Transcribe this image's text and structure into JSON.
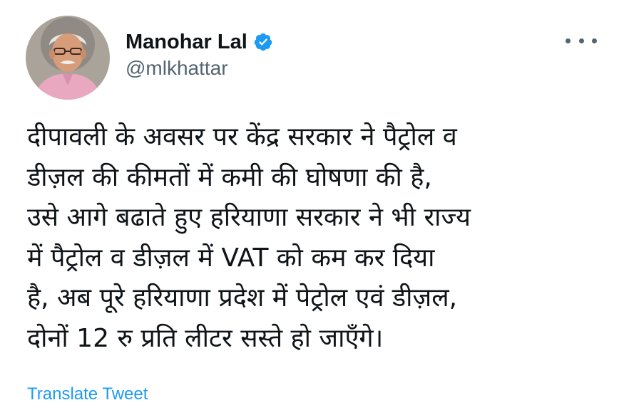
{
  "author": {
    "display_name": "Manohar Lal",
    "handle": "@mlkhattar",
    "verified": true,
    "avatar_icon": "profile-photo"
  },
  "menu": {
    "icon": "more-options-icon"
  },
  "tweet": {
    "lines": [
      "दीपावली के अवसर पर केंद्र सरकार ने पैट्रोल व",
      "डीज़ल की कीमतों में कमी की घोषणा की है,",
      "उसे आगे बढाते हुए हरियाणा सरकार ने भी राज्य",
      "में पैट्रोल व डीज़ल में VAT को कम कर दिया",
      "है, अब पूरे हरियाणा प्रदेश में पेट्रोल एवं डीज़ल,",
      "दोनों 12 रु प्रति लीटर सस्ते हो जाएँगे।"
    ]
  },
  "actions": {
    "translate_label": "Translate Tweet"
  },
  "colors": {
    "accent": "#1d9bf0",
    "text": "#0f1419",
    "secondary_text": "#536471"
  }
}
